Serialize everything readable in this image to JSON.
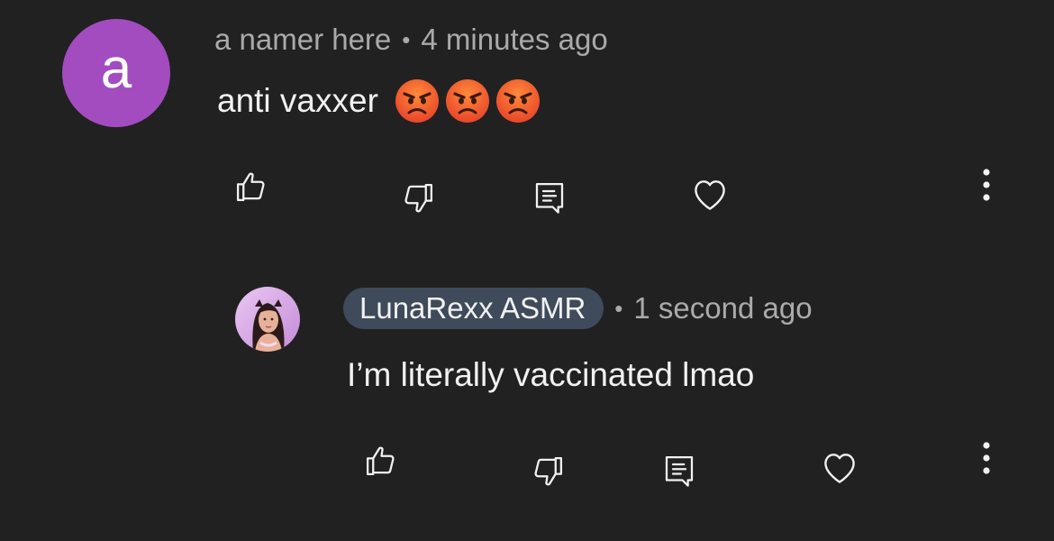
{
  "comment": {
    "avatar_letter": "a",
    "author": "a namer here",
    "separator": "•",
    "time": "4 minutes ago",
    "text": "anti vaxxer",
    "emojis": [
      "angry-face",
      "angry-face",
      "angry-face"
    ],
    "avatar_color": "#a24cbf"
  },
  "reply": {
    "author": "LunaRexx ASMR",
    "separator": "•",
    "time": "1 second ago",
    "text": "I’m literally vaccinated lmao",
    "author_badge_color": "#3f4a5a"
  },
  "actions": {
    "icons": [
      "thumbs-up-icon",
      "thumbs-down-icon",
      "reply-icon",
      "heart-icon",
      "more-vert-icon"
    ]
  },
  "colors": {
    "background": "#212121",
    "text_primary": "#f1f1f1",
    "text_secondary": "#aaaaaa"
  }
}
